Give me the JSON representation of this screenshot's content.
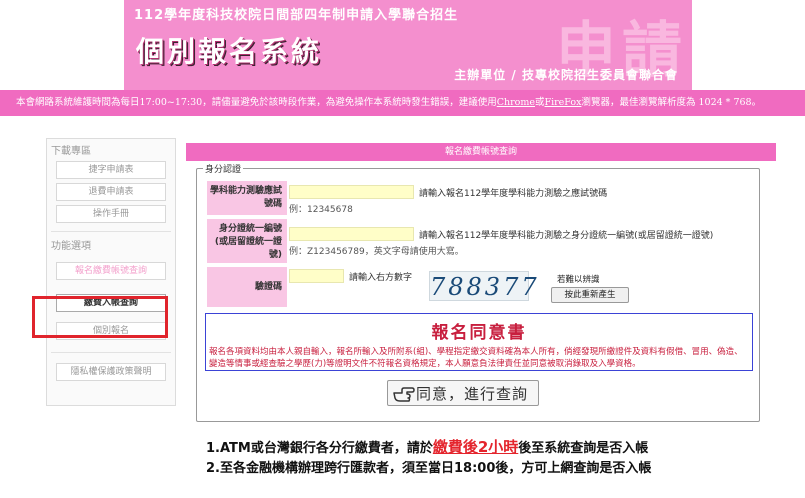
{
  "header": {
    "subtitle": "112學年度科技校院日間部四年制申請入學聯合招生",
    "title": "個別報名系統",
    "bg_chars": "申請",
    "organizer": "主辦單位 / 技專校院招生委員會聯合會"
  },
  "notice": {
    "part1": "本會網路系統維護時間為每日17:00~17:30，請儘量避免於該時段作業，為避免操作本系統時發生錯誤，建議使用",
    "link1": "Chrome",
    "or": "或",
    "link2": "FireFox",
    "part2": "瀏覽器，最佳瀏覽解析度為 1024 * 768。"
  },
  "sidebar": {
    "download_header": "下載專區",
    "download_items": [
      "捷字申請表",
      "退費申請表",
      "操作手冊"
    ],
    "function_header": "功能選項",
    "function_items": [
      "報名繳費帳號查詢",
      "繳費入帳查詢",
      "個別報名"
    ],
    "privacy": "隱私權保護政策聲明"
  },
  "main": {
    "section_title": "報名繳費帳號查詢",
    "legend": "身分認證",
    "exam_no_label": "學科能力測驗應試號碼",
    "exam_no_hint": "請輸入報名112學年度學科能力測驗之應試號碼",
    "exam_no_example": "例：12345678",
    "id_label": "身分證統一編號(或居留證統一證號)",
    "id_hint": "請輸入報名112學年度學科能力測驗之身分證統一編號(或居留證統一證號)",
    "id_example": "例：Z123456789，英文字母請使用大寫。",
    "captcha_label": "驗證碼",
    "captcha_hint": "請輸入右方數字",
    "captcha_value": "788377",
    "captcha_note": "若難以辨識",
    "refresh_button": "按此重新產生",
    "consent_title": "報名同意書",
    "consent_text": "報名各項資料均由本人親自輸入，報名所輸入及所附系(組)、學程指定繳交資料確為本人所有，倘經發現所繳證件及資料有假借、冒用、偽造、變造等情事或經查驗之學歷(力)等證明文件不符報名資格規定，本人願意負法律責任並同意被取消錄取及入學資格。",
    "query_button": "同意，進行查詢"
  },
  "notes": {
    "line1_pre": "1.ATM或台灣銀行各分行繳費者，請於",
    "line1_em": "繳費後2小時",
    "line1_post": "後至系統查詢是否入帳",
    "line2": "2.至各金融機構辦理跨行匯款者，須至當日18:00後，方可上網查詢是否入帳"
  }
}
